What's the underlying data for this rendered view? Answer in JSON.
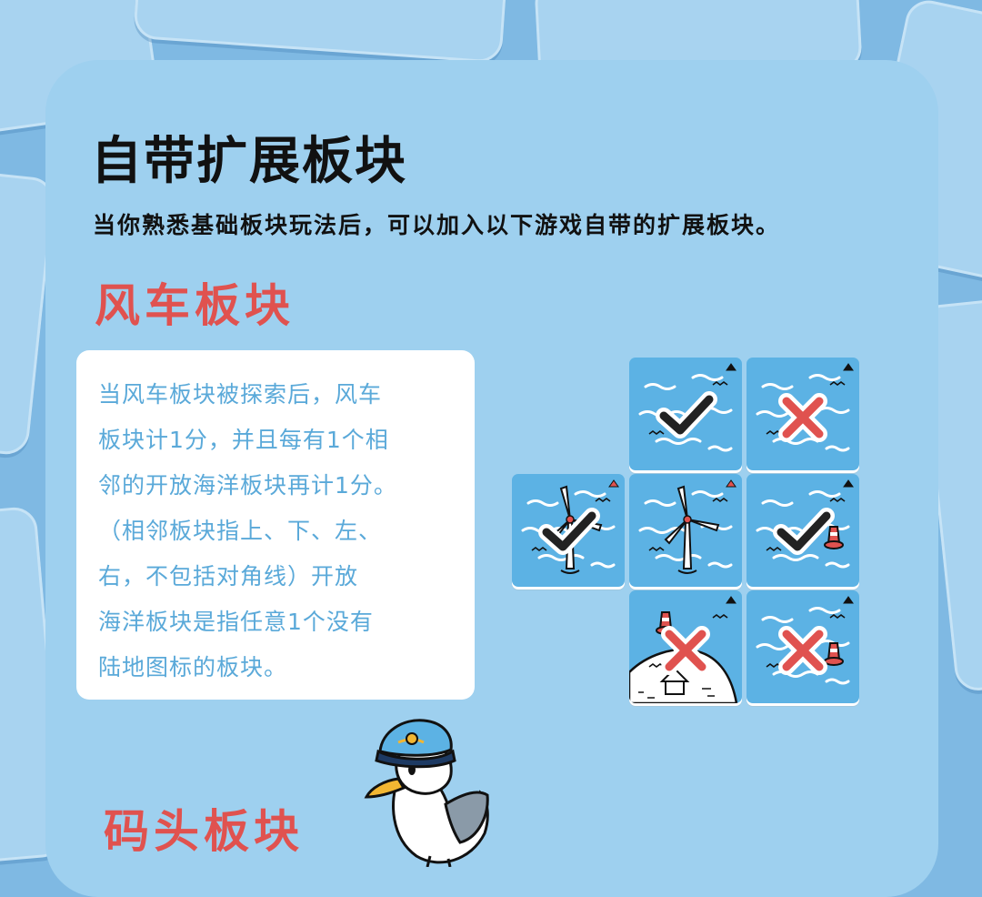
{
  "page": {
    "title": "自带扩展板块",
    "subtitle": "当你熟悉基础板块玩法后，可以加入以下游戏自带的扩展板块。"
  },
  "windmill_section": {
    "heading": "风车板块",
    "description_lines": [
      "当风车板块被探索后，风车",
      "板块计1分，并且每有1个相",
      "邻的开放海洋板块再计1分。",
      "（相邻板块指上、下、左、",
      "右，不包括对角线）开放",
      "海洋板块是指任意1个没有",
      "陆地图标的板块。"
    ]
  },
  "tile_grid": [
    {
      "id": "top-middle",
      "mark": "check",
      "marker_color": "#111111",
      "content": [
        "waves"
      ]
    },
    {
      "id": "top-right",
      "mark": "cross",
      "marker_color": "#111111",
      "content": [
        "waves"
      ]
    },
    {
      "id": "middle-left",
      "mark": "check",
      "marker_color": "#e0524f",
      "content": [
        "waves",
        "windmill"
      ]
    },
    {
      "id": "center",
      "mark": "none",
      "marker_color": "#e0524f",
      "content": [
        "waves",
        "windmill"
      ]
    },
    {
      "id": "middle-right",
      "mark": "check",
      "marker_color": "#111111",
      "content": [
        "waves",
        "buoy"
      ]
    },
    {
      "id": "bottom-middle",
      "mark": "cross",
      "marker_color": "#111111",
      "content": [
        "island",
        "lighthouse"
      ]
    },
    {
      "id": "bottom-right",
      "mark": "cross",
      "marker_color": "#111111",
      "content": [
        "waves",
        "buoy"
      ]
    }
  ],
  "dock_section": {
    "heading": "码头板块"
  },
  "mascot": {
    "icon": "seagull-captain-icon"
  },
  "colors": {
    "panel": "#9ed0ef",
    "heading_red": "#e0524f",
    "text_blue": "#5aa9d9",
    "tile_blue": "#5cb2e4",
    "cross_red": "#e0524f"
  }
}
